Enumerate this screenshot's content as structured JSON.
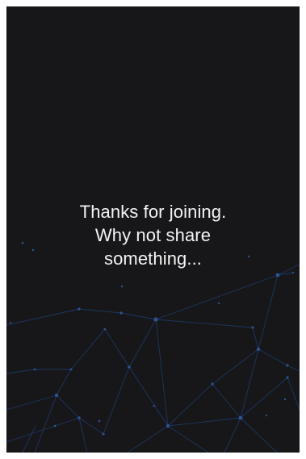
{
  "screen": {
    "background": "#17171a",
    "message_lines": [
      "Thanks for joining.",
      "Why not share",
      "something..."
    ]
  },
  "decoration": {
    "name": "network-constellation-background",
    "line_color": "#1c3a66",
    "node_color": "#2a5490"
  }
}
